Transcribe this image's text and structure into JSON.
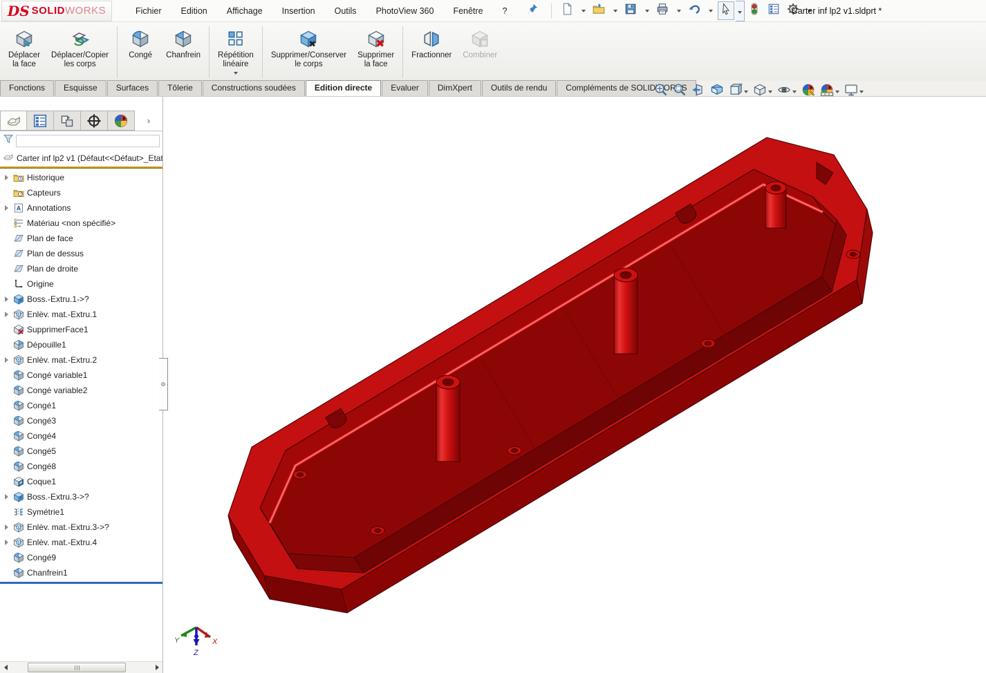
{
  "window": {
    "title": "Carter inf lp2 v1.sldprt *",
    "brand_prefix": "DS",
    "brand_bold": "SOLID",
    "brand_light": "WORKS"
  },
  "menubar": {
    "items": [
      "Fichier",
      "Edition",
      "Affichage",
      "Insertion",
      "Outils",
      "PhotoView 360",
      "Fenêtre",
      "?"
    ]
  },
  "quick_toolbar": [
    {
      "icon": "new-document-icon",
      "caret": true
    },
    {
      "icon": "open-folder-icon",
      "caret": true
    },
    {
      "icon": "save-icon",
      "caret": true
    },
    {
      "icon": "print-icon",
      "caret": true
    },
    {
      "icon": "undo-icon",
      "caret": true
    },
    {
      "icon": "select-cursor-icon",
      "caret": true,
      "boxed": true
    },
    {
      "icon": "traffic-light-icon",
      "caret": false
    },
    {
      "icon": "task-pane-icon",
      "caret": false
    },
    {
      "icon": "settings-gear-icon",
      "caret": true
    }
  ],
  "ribbon": {
    "groups": [
      {
        "buttons": [
          {
            "label": [
              "Déplacer",
              "la face"
            ],
            "icon": "move-face-icon"
          },
          {
            "label": [
              "Déplacer/Copier",
              "les corps"
            ],
            "icon": "move-copy-bodies-icon"
          }
        ]
      },
      {
        "buttons": [
          {
            "label": [
              "Congé"
            ],
            "icon": "fillet-icon"
          },
          {
            "label": [
              "Chanfrein"
            ],
            "icon": "chamfer-icon"
          }
        ]
      },
      {
        "buttons": [
          {
            "label": [
              "Répétition",
              "linéaire"
            ],
            "icon": "linear-pattern-icon",
            "dropdown": true
          }
        ]
      },
      {
        "buttons": [
          {
            "label": [
              "Supprimer/Conserver",
              "le corps"
            ],
            "icon": "delete-keep-body-icon"
          },
          {
            "label": [
              "Supprimer",
              "la face"
            ],
            "icon": "delete-face-icon"
          }
        ]
      },
      {
        "buttons": [
          {
            "label": [
              "Fractionner"
            ],
            "icon": "split-icon"
          },
          {
            "label": [
              "Combiner"
            ],
            "icon": "combine-icon",
            "disabled": true
          }
        ]
      }
    ]
  },
  "command_tabs": {
    "active": "Edition directe",
    "tabs": [
      "Fonctions",
      "Esquisse",
      "Surfaces",
      "Tôlerie",
      "Constructions soudées",
      "Edition directe",
      "Evaluer",
      "DimXpert",
      "Outils de rendu",
      "Compléments de SOLIDWORKS"
    ]
  },
  "view_toolbar": [
    {
      "icon": "zoom-fit-icon",
      "caret": false
    },
    {
      "icon": "zoom-area-icon",
      "caret": false
    },
    {
      "icon": "previous-view-icon",
      "caret": false
    },
    {
      "icon": "section-view-icon",
      "caret": false
    },
    {
      "icon": "view-orientation-icon",
      "caret": true
    },
    {
      "icon": "display-style-icon",
      "caret": true
    },
    {
      "icon": "hide-show-icon",
      "caret": true
    },
    {
      "icon": "edit-appearance-icon",
      "caret": false
    },
    {
      "icon": "apply-scene-icon",
      "caret": true
    },
    {
      "icon": "view-settings-icon",
      "caret": true
    }
  ],
  "feature_panel": {
    "manager_tabs": [
      "featuremanager-tab",
      "propertymanager-tab",
      "configurationmanager-tab",
      "dimxpertmanager-tab",
      "displaymanager-tab"
    ],
    "more_label": "›",
    "filter_placeholder": "",
    "root_label": "Carter inf lp2 v1  (Défaut<<Défaut>_Etat",
    "items": [
      {
        "label": "Historique",
        "icon": "folder-history-icon",
        "expandable": true
      },
      {
        "label": "Capteurs",
        "icon": "folder-sensors-icon",
        "expandable": false
      },
      {
        "label": "Annotations",
        "icon": "annotations-icon",
        "expandable": true
      },
      {
        "label": "Matériau <non spécifié>",
        "icon": "material-icon",
        "expandable": false
      },
      {
        "label": "Plan de face",
        "icon": "plane-icon",
        "expandable": false
      },
      {
        "label": "Plan de dessus",
        "icon": "plane-icon",
        "expandable": false
      },
      {
        "label": "Plan de droite",
        "icon": "plane-icon",
        "expandable": false
      },
      {
        "label": "Origine",
        "icon": "origin-icon",
        "expandable": false
      },
      {
        "label": "Boss.-Extru.1->?",
        "icon": "boss-extrude-icon",
        "expandable": true
      },
      {
        "label": "Enlèv. mat.-Extru.1",
        "icon": "cut-extrude-icon",
        "expandable": true
      },
      {
        "label": "SupprimerFace1",
        "icon": "delete-face-tree-icon",
        "expandable": false
      },
      {
        "label": "Dépouille1",
        "icon": "draft-icon",
        "expandable": false
      },
      {
        "label": "Enlèv. mat.-Extru.2",
        "icon": "cut-extrude-icon",
        "expandable": true
      },
      {
        "label": "Congé variable1",
        "icon": "fillet-tree-icon",
        "expandable": false
      },
      {
        "label": "Congé variable2",
        "icon": "fillet-tree-icon",
        "expandable": false
      },
      {
        "label": "Congé1",
        "icon": "fillet-tree-icon",
        "expandable": false
      },
      {
        "label": "Congé3",
        "icon": "fillet-tree-icon",
        "expandable": false
      },
      {
        "label": "Congé4",
        "icon": "fillet-tree-icon",
        "expandable": false
      },
      {
        "label": "Congé5",
        "icon": "fillet-tree-icon",
        "expandable": false
      },
      {
        "label": "Congé8",
        "icon": "fillet-tree-icon",
        "expandable": false
      },
      {
        "label": "Coque1",
        "icon": "shell-icon",
        "expandable": false
      },
      {
        "label": "Boss.-Extru.3->?",
        "icon": "boss-extrude-icon",
        "expandable": true
      },
      {
        "label": "Symétrie1",
        "icon": "mirror-icon",
        "expandable": false
      },
      {
        "label": "Enlèv. mat.-Extru.3->?",
        "icon": "cut-extrude-icon",
        "expandable": true
      },
      {
        "label": "Enlèv. mat.-Extru.4",
        "icon": "cut-extrude-icon",
        "expandable": true
      },
      {
        "label": "Congé9",
        "icon": "fillet-tree-icon",
        "expandable": false
      },
      {
        "label": "Chanfrein1",
        "icon": "chamfer-tree-icon",
        "expandable": false
      }
    ]
  },
  "viewport": {
    "part_color": "#c41010",
    "triad_labels": {
      "x": "X",
      "y": "Y",
      "z": "Z"
    }
  }
}
